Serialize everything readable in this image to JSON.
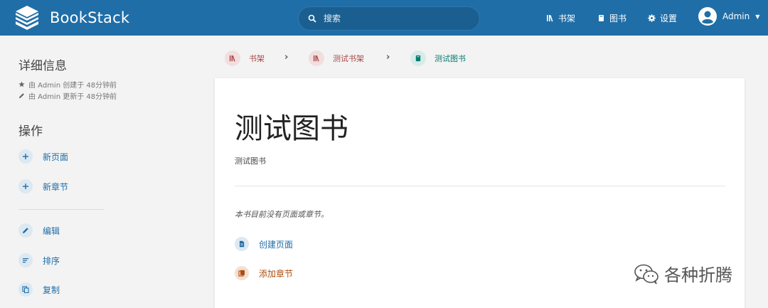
{
  "app": {
    "name": "BookStack"
  },
  "search": {
    "placeholder": "搜索"
  },
  "nav": {
    "shelves": "书架",
    "books": "图书",
    "settings": "设置"
  },
  "user": {
    "name": "Admin"
  },
  "sidebar": {
    "details_title": "详细信息",
    "created": "由 Admin 创建于 48分钟前",
    "updated": "由 Admin 更新于 48分钟前",
    "actions_title": "操作",
    "actions": [
      {
        "label": "新页面",
        "icon": "plus-icon"
      },
      {
        "label": "新章节",
        "icon": "plus-icon"
      },
      {
        "label": "编辑",
        "icon": "pencil-icon"
      },
      {
        "label": "排序",
        "icon": "sort-icon"
      },
      {
        "label": "复制",
        "icon": "copy-icon"
      }
    ]
  },
  "breadcrumbs": [
    {
      "label": "书架",
      "icon": "shelf-icon",
      "color": "#a94747"
    },
    {
      "label": "测试书架",
      "icon": "shelf-icon",
      "color": "#a94747"
    },
    {
      "label": "测试图书",
      "icon": "book-icon",
      "color": "#077b70"
    }
  ],
  "book": {
    "title": "测试图书",
    "description": "测试图书",
    "empty_message": "本书目前没有页面或章节。",
    "create_page": "创建页面",
    "add_chapter": "添加章节"
  },
  "colors": {
    "header": "#206ea7",
    "page": "#206ea7",
    "chapter": "#af4d0d",
    "shelf": "#a94747",
    "book": "#077b70"
  },
  "watermark": {
    "text": "各种折腾"
  }
}
